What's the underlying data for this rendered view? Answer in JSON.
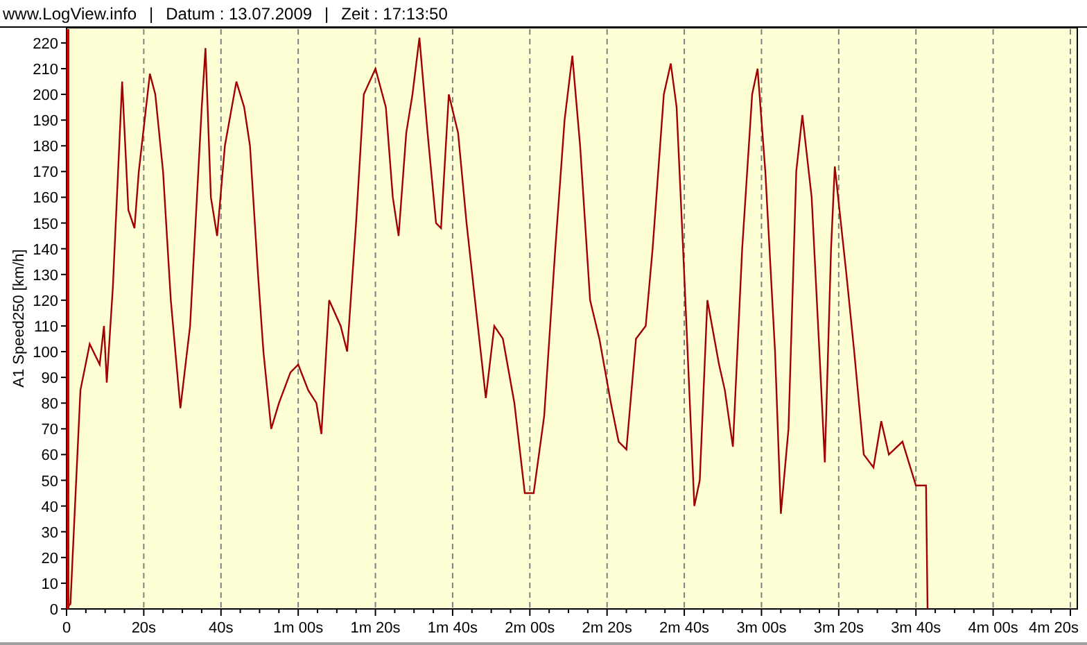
{
  "header": {
    "items": [
      "www.LogView.info",
      "|",
      "Datum : 13.07.2009",
      "|",
      "Zeit : 17:13:50"
    ]
  },
  "chart": {
    "chart_data": {
      "type": "line",
      "ylabel": "A1 Speed250 [km/h]",
      "x": [
        0,
        1,
        3.6,
        6,
        8.6,
        9.7,
        10.4,
        12,
        14.4,
        16,
        17.6,
        18.7,
        21.6,
        23,
        25,
        27,
        29.5,
        32,
        35,
        36,
        37.4,
        39,
        41,
        44,
        46,
        47.5,
        49.6,
        51,
        53,
        55,
        58,
        60,
        62.6,
        64.7,
        66,
        68,
        71,
        72.7,
        75,
        77,
        80,
        82.7,
        84.5,
        86,
        88,
        89.6,
        91.4,
        93.5,
        95.7,
        97,
        99,
        101.4,
        103.6,
        105.8,
        108.6,
        110.8,
        113,
        116,
        118.7,
        121,
        123.7,
        126.6,
        129,
        131,
        133,
        135.6,
        138,
        141,
        143,
        145,
        147.5,
        150,
        151.8,
        154.7,
        156.5,
        158,
        160,
        162.6,
        164,
        166,
        169,
        170.5,
        172.6,
        175,
        177.6,
        179,
        181,
        183.5,
        185,
        187,
        189,
        190.6,
        193,
        195,
        196.4,
        198,
        199,
        202,
        204,
        206.5,
        209,
        211,
        213,
        216.5,
        220,
        222.6,
        223
      ],
      "grid": true,
      "series": [
        {
          "color": "#a00000",
          "values": [
            0,
            2,
            85,
            103,
            95,
            110,
            88,
            125,
            205,
            155,
            148,
            170,
            208,
            200,
            170,
            120,
            78,
            110,
            195,
            218,
            160,
            145,
            180,
            205,
            195,
            180,
            130,
            100,
            70,
            80,
            92,
            95,
            85,
            80,
            68,
            120,
            110,
            100,
            150,
            200,
            210,
            195,
            160,
            145,
            185,
            200,
            222,
            185,
            150,
            148,
            200,
            185,
            150,
            120,
            82,
            110,
            105,
            80,
            45,
            45,
            75,
            140,
            190,
            215,
            180,
            120,
            105,
            80,
            65,
            62,
            105,
            110,
            140,
            200,
            212,
            195,
            130,
            40,
            50,
            120,
            95,
            85,
            63,
            140,
            200,
            210,
            170,
            100,
            37,
            70,
            170,
            192,
            160,
            100,
            57,
            140,
            172,
            130,
            100,
            60,
            55,
            73,
            60,
            65,
            48,
            48,
            0
          ]
        }
      ],
      "xlim": [
        0,
        260
      ],
      "ylim": [
        0,
        225.9
      ],
      "xticks": [
        {
          "value": 0,
          "label": "0"
        },
        {
          "value": 20,
          "label": "20s"
        },
        {
          "value": 40,
          "label": "40s"
        },
        {
          "value": 60,
          "label": "1m 00s"
        },
        {
          "value": 80,
          "label": "1m 20s"
        },
        {
          "value": 100,
          "label": "1m 40s"
        },
        {
          "value": 120,
          "label": "2m 00s"
        },
        {
          "value": 140,
          "label": "2m 20s"
        },
        {
          "value": 160,
          "label": "2m 40s"
        },
        {
          "value": 180,
          "label": "3m 00s"
        },
        {
          "value": 200,
          "label": "3m 20s"
        },
        {
          "value": 220,
          "label": "3m 40s"
        },
        {
          "value": 240,
          "label": "4m 00s"
        },
        {
          "value": 260,
          "label": "4m 20s"
        }
      ],
      "yticks": [
        0,
        10,
        20,
        30,
        40,
        50,
        60,
        70,
        80,
        90,
        100,
        110,
        120,
        130,
        140,
        150,
        160,
        170,
        180,
        190,
        200,
        210,
        220
      ]
    }
  }
}
